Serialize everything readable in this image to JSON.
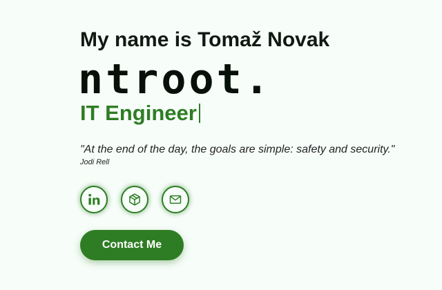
{
  "hero": {
    "intro": "My name is Tomaž Novak",
    "handle": "ntroot.",
    "role": "IT Engineer",
    "quote": "\"At the end of the day, the goals are simple: safety and security.\"",
    "quote_author": "Jodi Rell"
  },
  "socials": [
    {
      "icon": "linkedin-icon"
    },
    {
      "icon": "package-icon"
    },
    {
      "icon": "mail-icon"
    }
  ],
  "contact_button": {
    "label": "Contact Me"
  },
  "colors": {
    "accent": "#2e7d24",
    "background": "#f7fdf9",
    "text": "#0b1a10"
  }
}
